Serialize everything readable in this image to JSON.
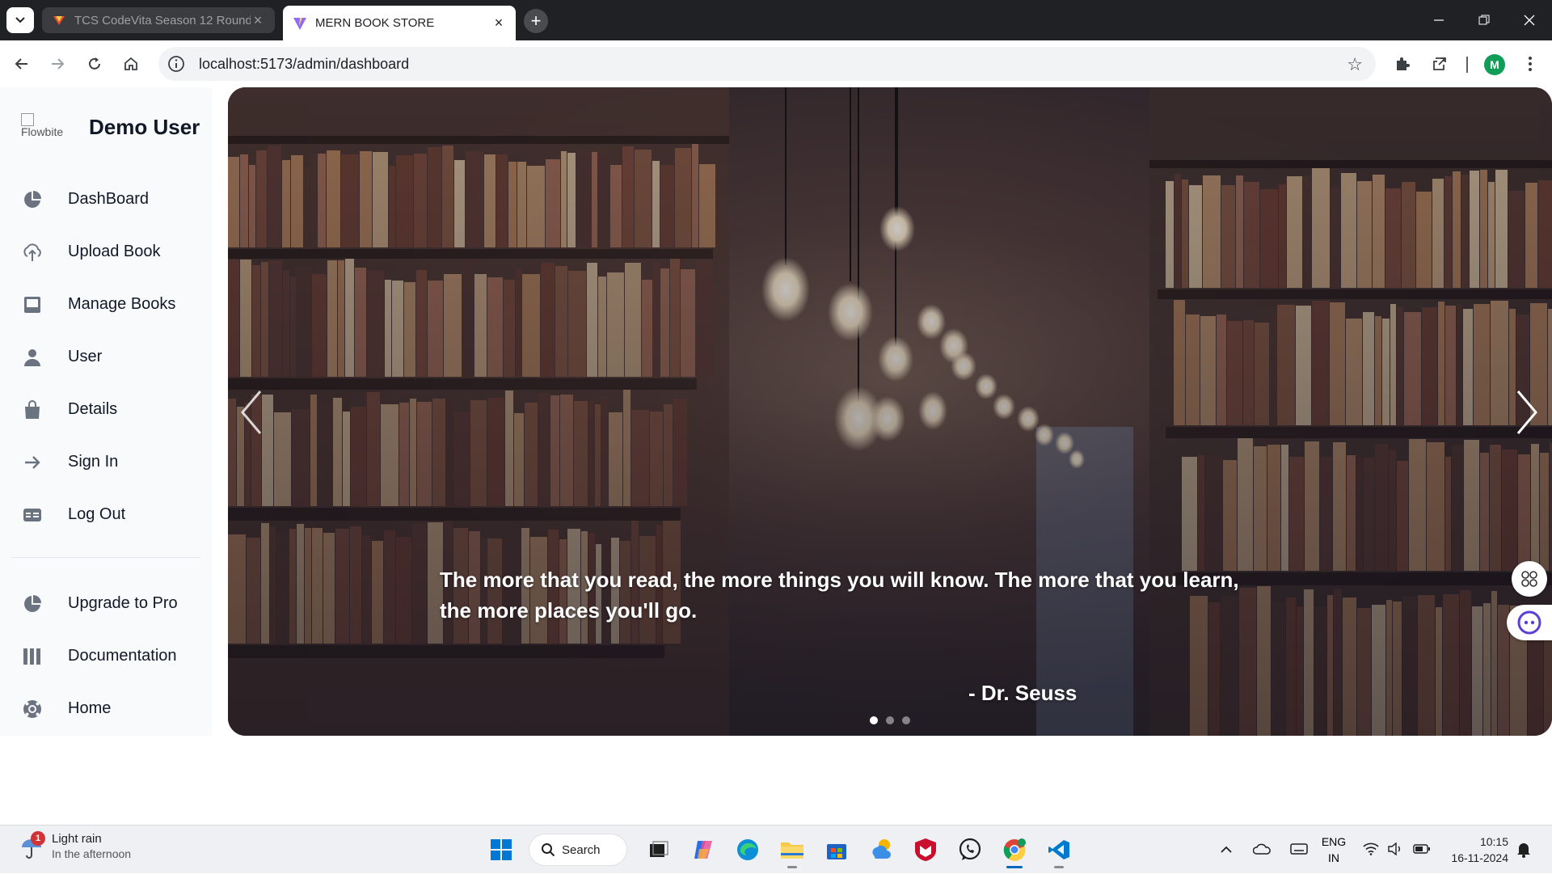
{
  "browser": {
    "tabs": [
      {
        "title": "TCS CodeVita Season 12 Round",
        "active": false
      },
      {
        "title": "MERN BOOK STORE",
        "active": true
      }
    ],
    "new_tab": "+",
    "url": "localhost:5173/admin/dashboard",
    "profile_initial": "M"
  },
  "sidebar": {
    "logo_alt": "Flowbite",
    "user_name": "Demo User",
    "items": [
      {
        "label": "DashBoard",
        "icon": "pie-chart-icon"
      },
      {
        "label": "Upload Book",
        "icon": "cloud-upload-icon"
      },
      {
        "label": "Manage Books",
        "icon": "inbox-icon"
      },
      {
        "label": "User",
        "icon": "user-icon"
      },
      {
        "label": "Details",
        "icon": "shopping-bag-icon"
      },
      {
        "label": "Sign In",
        "icon": "arrow-right-icon"
      },
      {
        "label": "Log Out",
        "icon": "table-icon"
      }
    ],
    "secondary_items": [
      {
        "label": "Upgrade to Pro",
        "icon": "pie-chart-icon"
      },
      {
        "label": "Documentation",
        "icon": "columns-icon"
      },
      {
        "label": "Home",
        "icon": "lifebuoy-icon"
      }
    ]
  },
  "hero": {
    "quote": "The more that you read, the more things you will know. The more that you learn, the more places you'll go.",
    "author": "- Dr. Seuss",
    "slide_count": 3,
    "active_slide": 1
  },
  "taskbar": {
    "weather_title": "Light rain",
    "weather_sub": "In the afternoon",
    "weather_badge": "1",
    "search_label": "Search",
    "lang_top": "ENG",
    "lang_bottom": "IN",
    "time": "10:15",
    "date": "16-11-2024"
  },
  "colors": {
    "sidebar_bg": "#f9fafb",
    "chrome_dark": "#202124",
    "taskbar_bg": "#eef0f3"
  }
}
